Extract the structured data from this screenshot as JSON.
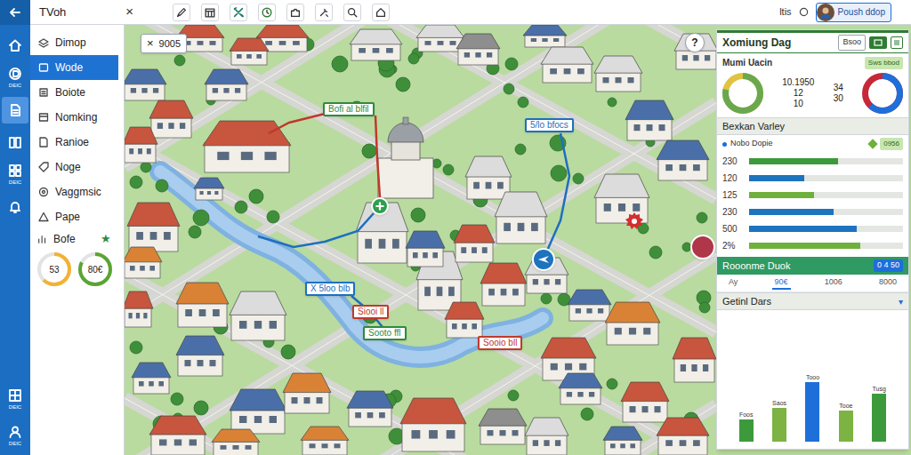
{
  "app": {
    "title": "TVoh",
    "close": "×"
  },
  "user": {
    "label": "ltis",
    "name": "Poush ddop"
  },
  "rail": {
    "items": [
      {
        "selected": false
      },
      {
        "label": "DEIC",
        "selected": false
      },
      {
        "selected": true
      },
      {
        "selected": false
      },
      {
        "label": "DEIC",
        "selected": false
      },
      {
        "selected": false
      }
    ],
    "bottom": [
      {
        "label": "DEIC",
        "selected": false
      },
      {
        "label": "DEIC",
        "selected": false
      }
    ]
  },
  "sidebar": {
    "items": [
      {
        "label": "Dimop",
        "selected": false
      },
      {
        "label": "Wode",
        "selected": true
      },
      {
        "label": "Boiote",
        "selected": false
      },
      {
        "label": "Nomking",
        "selected": false
      },
      {
        "label": "Ranioe",
        "selected": false
      },
      {
        "label": "Noge",
        "selected": false
      },
      {
        "label": "Vaggmsic",
        "selected": false
      },
      {
        "label": "Pape",
        "selected": false
      }
    ],
    "footer": {
      "label": "Bofe",
      "star": "★"
    },
    "gauges": [
      {
        "value": "53",
        "level": 0.62,
        "color": "#f2b233"
      },
      {
        "value": "80€",
        "level": 0.82,
        "color": "#5aa532"
      }
    ]
  },
  "map": {
    "close": "×",
    "zoom": "9005",
    "help": "?",
    "labels": [
      {
        "text": "Bofi al blfil",
        "color": "#2e8b3e"
      },
      {
        "text": "5/lo bfocs",
        "color": "#1e6fbf"
      },
      {
        "text": "X 5loo blb",
        "color": "#1e6fbf"
      },
      {
        "text": "Siooi ll",
        "color": "#c0392b"
      },
      {
        "text": "Sooto ffl",
        "color": "#2e8b3e"
      },
      {
        "text": "Sooio bll",
        "color": "#c0392b"
      }
    ],
    "pins": [
      {
        "kind": "plus",
        "color": "#2e9e4f"
      },
      {
        "kind": "plane",
        "color": "#1e73be"
      },
      {
        "kind": "gear",
        "color": "#d32f2f"
      },
      {
        "kind": "dot",
        "color": "#b0364a"
      }
    ]
  },
  "panel": {
    "title": "Xomiung Dag",
    "buttons": [
      "Bsoo"
    ],
    "subtitle": "Mumi Uacin",
    "badge": "Sws bbod",
    "donuts": [
      {
        "level": 0.78,
        "color": "#6aa84f",
        "rest": "#e0c341",
        "readings": [
          "10.1950",
          "12",
          "10"
        ]
      },
      {
        "level": 0.62,
        "color": "#1e6fd9",
        "rest": "#c62839",
        "readings": [
          "34",
          "30"
        ]
      }
    ],
    "section": {
      "title": "Bexkan Varley",
      "subtitle": "Nobo Dopie",
      "badge": "0956",
      "bars": [
        {
          "label": "230",
          "level": 0.58,
          "color": "#3c9a3c"
        },
        {
          "label": "120",
          "level": 0.36,
          "color": "#1e73be"
        },
        {
          "label": "125",
          "level": 0.42,
          "color": "#6fb03c"
        },
        {
          "label": "230",
          "level": 0.55,
          "color": "#1e73be"
        },
        {
          "label": "500",
          "level": 0.7,
          "color": "#1e73be"
        },
        {
          "label": "2%",
          "level": 0.72,
          "color": "#6fb03c"
        }
      ]
    },
    "summary": {
      "title": "Rooonme Duok",
      "value": "0 4 50",
      "columns": [
        {
          "label": "Ay",
          "selected": false
        },
        {
          "label": "90€",
          "selected": true
        },
        {
          "label": "1006",
          "selected": false
        },
        {
          "label": "8000",
          "selected": false
        }
      ]
    },
    "chart": {
      "title": "Getinl Dars",
      "toggle": "▾",
      "categories": [
        "Foos",
        "Saos",
        "Tooo",
        "Tooe",
        "Tusg"
      ],
      "values": [
        30,
        45,
        80,
        42,
        65
      ],
      "colors": [
        "#3c9a3c",
        "#7cb342",
        "#1e6fd9",
        "#7cb342",
        "#3c9a3c"
      ]
    }
  }
}
